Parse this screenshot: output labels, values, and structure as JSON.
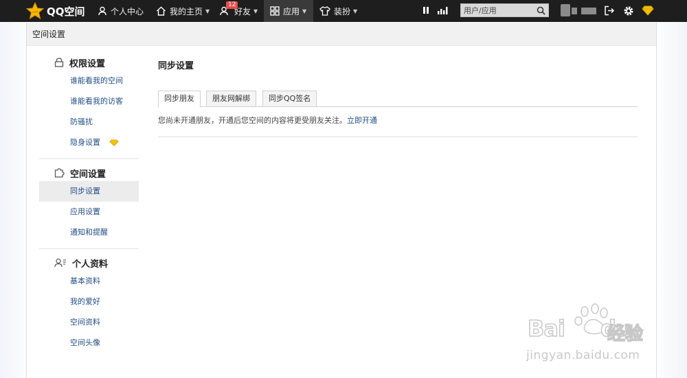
{
  "topbar": {
    "logo_text": "QQ空间",
    "nav": [
      {
        "label": "个人中心"
      },
      {
        "label": "我的主页"
      },
      {
        "label": "好友",
        "badge": "12"
      },
      {
        "label": "应用"
      },
      {
        "label": "装扮"
      }
    ],
    "search": {
      "placeholder": "用户/应用"
    }
  },
  "page": {
    "header_title": "空间设置"
  },
  "sidebar": {
    "sections": [
      {
        "title": "权限设置",
        "items": [
          "谁能看我的空间",
          "谁能看我的访客",
          "防骚扰",
          "隐身设置"
        ]
      },
      {
        "title": "空间设置",
        "items": [
          "同步设置",
          "应用设置",
          "通知和提醒"
        ],
        "active_item": "同步设置"
      },
      {
        "title": "个人资料",
        "items": [
          "基本资料",
          "我的爱好",
          "空间资料",
          "空间头像"
        ]
      }
    ]
  },
  "main": {
    "title": "同步设置",
    "tabs": [
      "同步朋友",
      "朋友网解绑",
      "同步QQ签名"
    ],
    "active_tab": "同步朋友",
    "notice_text": "您尚未开通朋友，开通后您空间的内容将更受朋友关注。",
    "notice_link": "立即开通"
  },
  "watermark": {
    "brand": "Bai",
    "brand_suffix": "du",
    "cn": "经验",
    "url": "jingyan.baidu.com"
  },
  "colors": {
    "topbar_bg": "#1e1e1e",
    "link": "#224e86",
    "badge": "#e64e4e",
    "gem": "#f2c300"
  }
}
